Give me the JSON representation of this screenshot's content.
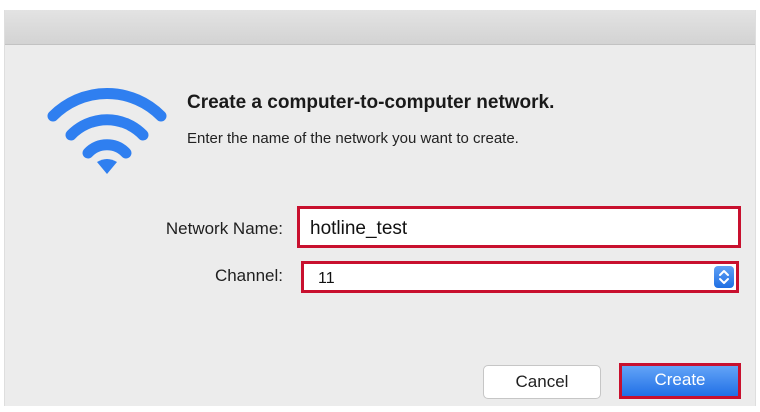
{
  "dialog": {
    "title": "Create a computer-to-computer network.",
    "subtitle": "Enter the name of the network you want to create.",
    "icon": "wifi-icon",
    "accent_color": "#2f7ff0",
    "highlight_color": "#c8102e"
  },
  "fields": {
    "network_name": {
      "label": "Network Name:",
      "value": "hotline_test"
    },
    "channel": {
      "label": "Channel:",
      "value": "11"
    }
  },
  "buttons": {
    "cancel": "Cancel",
    "create": "Create"
  }
}
